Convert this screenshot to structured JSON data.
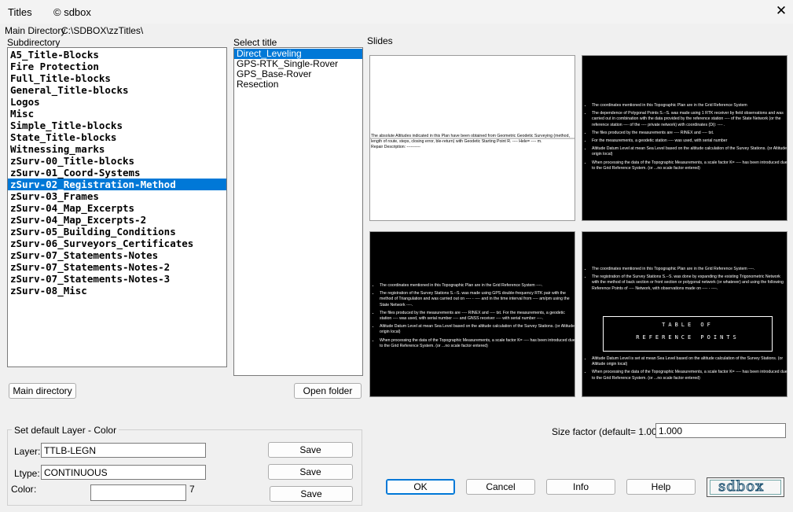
{
  "window": {
    "title": "Titles",
    "brand": "© sdbox",
    "close_icon": "close-icon"
  },
  "main_directory": {
    "label": "Main Directory",
    "path": "C:\\SDBOX\\zzTitles\\"
  },
  "subdirectory": {
    "label": "Subdirectory",
    "items": [
      "A5_Title-Blocks",
      "Fire Protection",
      "Full_Title-blocks",
      "General_Title-blocks",
      "Logos",
      "Misc",
      "Simple_Title-blocks",
      "State_Title-blocks",
      "Witnessing_marks",
      "zSurv-00_Title-blocks",
      "zSurv-01_Coord-Systems",
      "zSurv-02_Registration-Method",
      "zSurv-03_Frames",
      "zSurv-04_Map_Excerpts",
      "zSurv-04_Map_Excerpts-2",
      "zSurv-05_Building_Conditions",
      "zSurv-06_Surveyors_Certificates",
      "zSurv-07_Statements-Notes",
      "zSurv-07_Statements-Notes-2",
      "zSurv-07_Statements-Notes-3",
      "zSurv-08_Misc"
    ],
    "selected_index": 11
  },
  "select_title": {
    "label": "Select title",
    "items": [
      "Direct_Leveling",
      "GPS-RTK_Single-Rover",
      "GPS_Base-Rover",
      "Resection"
    ],
    "selected_index": 0
  },
  "slides": {
    "label": "Slides",
    "slide1": "The absolute Altitudes indicated in this Plan have been obtained from Geometric Geodetic Surveying (method, length of route, steps, closing error, ble-return) with Geodetic Starting Point R. ---- Hele= ---- m.",
    "slide1_b": "Repair Description: ----------",
    "slide2": [
      "The coordinates mentioned in this Topographic Plan are in the Grid Reference System",
      "The dependence of Polygonal Points S.--S. was made using 1 RTK receiver by field observations and was carried out in combination with the data provided by the reference station ---- of the State Network (or the reference station ---- of the ---- private network) with coordinates (Di): ---- .",
      "The files produced by the measurements are ---- RINEX and ---- txt.",
      "For the measurements, a geodetic station ---- was used, with serial number",
      "Altitude Datum Level at mean Sea Level based on the altitude calculation of the Survey Stations. (or Altitude origin local)",
      "When processing the data of the Topographic Measurements, a scale factor K= ---- has been introduced due to the Grid Reference System. (or ...no scale factor entered)"
    ],
    "slide3": [
      "The coordinates mentioned in this Topographic Plan are in the Grid Reference System ----.",
      "The registration of the Survey Stations S.--S. was made using GPS double-frequency RTK pair with the method of Triangulation and was carried out on ---- - ---- and in the time interval from ---- am/pm using the State Network ----.",
      "The files produced by the measurements are ---- RINEX and ---- txt. For the measurements, a geodetic station ---- was used, with serial number ---- and GNSS receiver ---- with serial number ----.",
      "Altitude Datum Level at mean Sea Level based on the altitude calculation of the Survey Stations. (or Altitude origin local)",
      "When processing the data of the Topographic Measurements, a scale factor K= ---- has been introduced due to the Grid Reference System. (or ...no scale factor entered)"
    ],
    "slide4": [
      "The coordinates mentioned in this Topographic Plan are in the Grid Reference System ----.",
      "The registration of the Survey Stations S.--S. was done by expanding the existing Trigonometric Network with the method of back section or front section or polygonal network (or whatever) and using the following Reference Points of ---- Network, with observations made on ---- - ----."
    ],
    "slide4_table_l1": "TABLE OF",
    "slide4_table_l2": "REFERENCE POINTS",
    "slide4_b": [
      "Altitude Datum Level is set at mean Sea Level based on the altitude calculation of the Survey Stations. (or Altitude origin local)",
      "When processing the data of the Topographic Measurements, a scale factor K= ---- has been introduced due to the Grid Reference System. (or ...no scale factor entered)"
    ]
  },
  "buttons": {
    "main_directory": "Main directory",
    "open_folder": "Open folder",
    "save": "Save",
    "ok": "OK",
    "cancel": "Cancel",
    "info": "Info",
    "help": "Help"
  },
  "layer_color": {
    "group_label": "Set default Layer - Color",
    "layer_label": "Layer:",
    "layer_value": "TTLB-LEGN",
    "ltype_label": "Ltype:",
    "ltype_value": "CONTINUOUS",
    "color_label": "Color",
    "color_sep": ":",
    "color_value": "",
    "color_index": "7"
  },
  "size_factor": {
    "label": "Size factor  (default= 1.00):",
    "value": "1.000"
  },
  "logo": {
    "text": "sdbox"
  }
}
